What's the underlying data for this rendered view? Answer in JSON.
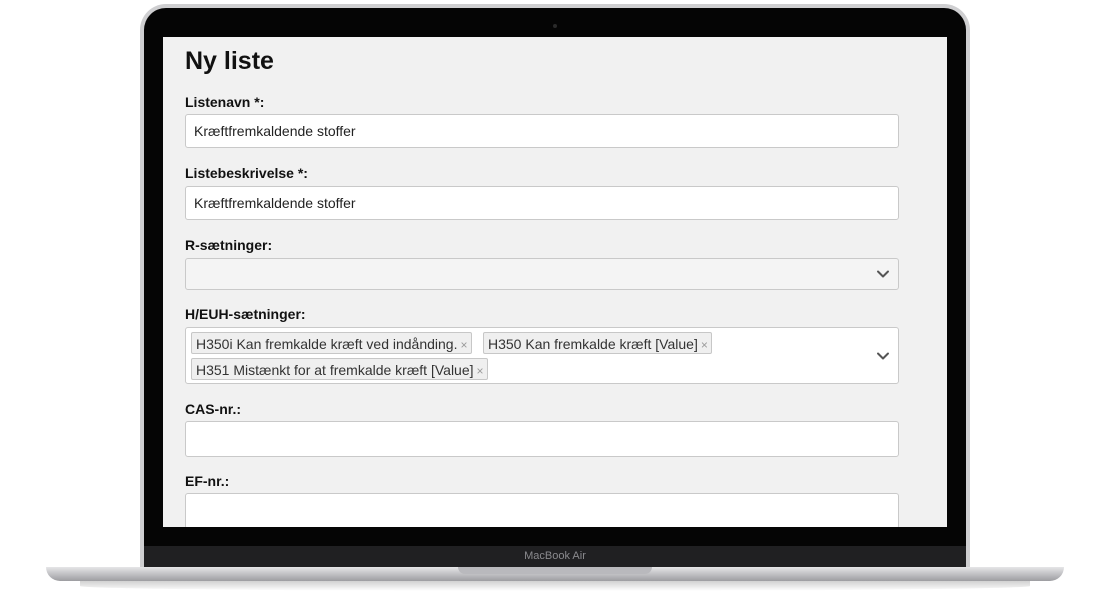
{
  "device": {
    "brand": "MacBook Air"
  },
  "form": {
    "title": "Ny liste",
    "list_name": {
      "label": "Listenavn *:",
      "value": "Kræftfremkaldende stoffer"
    },
    "list_description": {
      "label": "Listebeskrivelse *:",
      "value": "Kræftfremkaldende stoffer"
    },
    "r_phrases": {
      "label": "R-sætninger:",
      "value": ""
    },
    "h_phrases": {
      "label": "H/EUH-sætninger:",
      "tags": [
        "H350i Kan fremkalde kræft ved indånding.",
        "H350 Kan fremkalde kræft [Value]",
        "H351 Mistænkt for at fremkalde kræft [Value]"
      ],
      "remove_symbol": "×"
    },
    "cas_number": {
      "label": "CAS-nr.:",
      "value": ""
    },
    "ef_number": {
      "label": "EF-nr.:",
      "value": ""
    }
  },
  "icons": {
    "dropdown": "chevron-down-icon",
    "remove": "close-icon"
  }
}
